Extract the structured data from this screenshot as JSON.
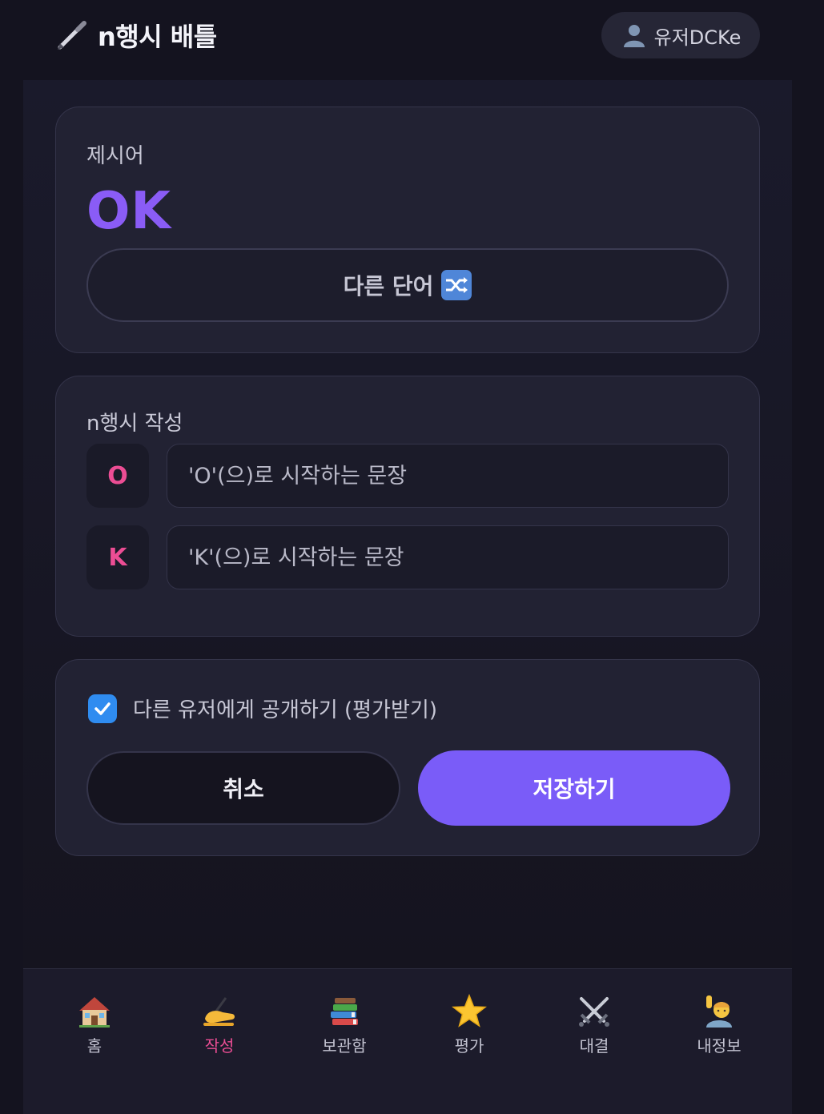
{
  "header": {
    "app_title": "n행시 배틀",
    "app_icon": "pen-icon",
    "user_name": "유저DCKe",
    "user_icon": "user-silhouette-icon"
  },
  "prompt_card": {
    "label": "제시어",
    "word": "OK",
    "change_button_label": "다른 단어",
    "change_button_icon": "shuffle-icon"
  },
  "write_card": {
    "label": "n행시 작성",
    "lines": [
      {
        "letter": "O",
        "placeholder": "'O'(으)로 시작하는 문장",
        "value": ""
      },
      {
        "letter": "K",
        "placeholder": "'K'(으)로 시작하는 문장",
        "value": ""
      }
    ]
  },
  "save_card": {
    "public_checkbox_label": "다른 유저에게 공개하기 (평가받기)",
    "public_checked": true,
    "cancel_label": "취소",
    "save_label": "저장하기"
  },
  "bottom_nav": {
    "items": [
      {
        "label": "홈",
        "icon": "house-icon",
        "active": false
      },
      {
        "label": "작성",
        "icon": "writing-hand-icon",
        "active": true
      },
      {
        "label": "보관함",
        "icon": "books-icon",
        "active": false
      },
      {
        "label": "평가",
        "icon": "star-icon",
        "active": false
      },
      {
        "label": "대결",
        "icon": "crossed-swords-icon",
        "active": false
      },
      {
        "label": "내정보",
        "icon": "person-raising-hand-icon",
        "active": false
      }
    ]
  },
  "colors": {
    "background": "#14131f",
    "card": "#222233",
    "accent_purple": "#8a5cf6",
    "save_button": "#7a5cf8",
    "letter_pink": "#ec4d94",
    "checkbox_blue": "#2f8cf0"
  }
}
